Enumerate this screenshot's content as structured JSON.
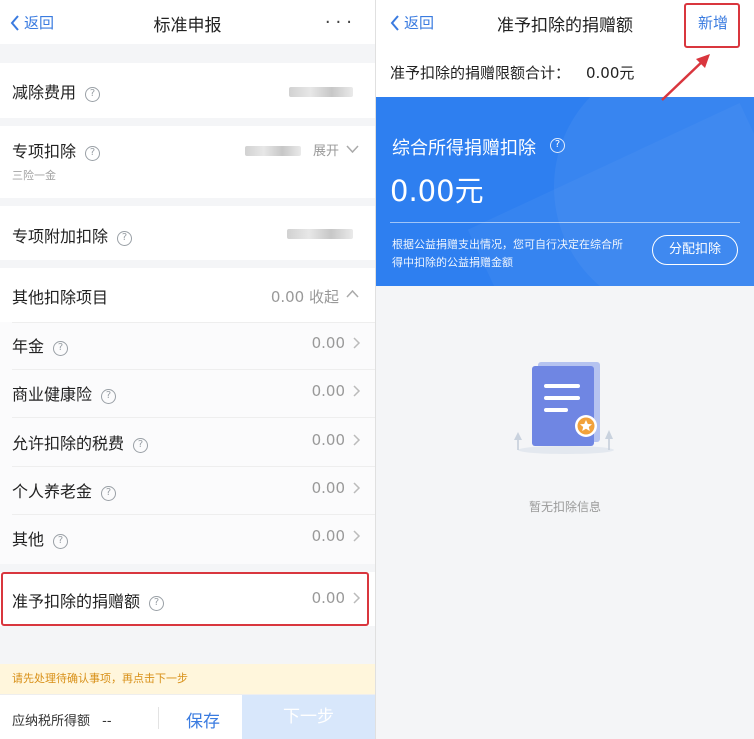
{
  "left": {
    "nav": {
      "back": "返回",
      "title": "标准申报",
      "more": "···"
    },
    "rows": {
      "reduction": {
        "label": "减除费用"
      },
      "special": {
        "label": "专项扣除",
        "sub": "三险一金",
        "expand": "展开"
      },
      "special_additional": {
        "label": "专项附加扣除"
      },
      "other": {
        "label": "其他扣除项目",
        "value": "0.00 收起"
      },
      "annuity": {
        "label": "年金",
        "value": "0.00"
      },
      "health": {
        "label": "商业健康险",
        "value": "0.00"
      },
      "taxes": {
        "label": "允许扣除的税费",
        "value": "0.00"
      },
      "pension": {
        "label": "个人养老金",
        "value": "0.00"
      },
      "others": {
        "label": "其他",
        "value": "0.00"
      },
      "donation": {
        "label": "准予扣除的捐赠额",
        "value": "0.00"
      }
    },
    "notice": "请先处理待确认事项，再点击下一步",
    "bottom": {
      "tax_label": "应纳税所得额",
      "tax_value": "--",
      "save": "保存",
      "next": "下一步"
    }
  },
  "right": {
    "nav": {
      "back": "返回",
      "title": "准予扣除的捐赠额",
      "add": "新增"
    },
    "limit": {
      "label": "准予扣除的捐赠限额合计：",
      "value": "0.00元"
    },
    "banner": {
      "title": "综合所得捐赠扣除",
      "amount": "0.00元",
      "desc": "根据公益捐赠支出情况，您可自行决定在综合所得中扣除的公益捐赠金额",
      "button": "分配扣除",
      "color": "#2e7ff0"
    },
    "empty": "暂无扣除信息"
  },
  "colors": {
    "accent": "#3a7be0",
    "highlight": "#d9363e",
    "notice_text": "#d89018"
  }
}
